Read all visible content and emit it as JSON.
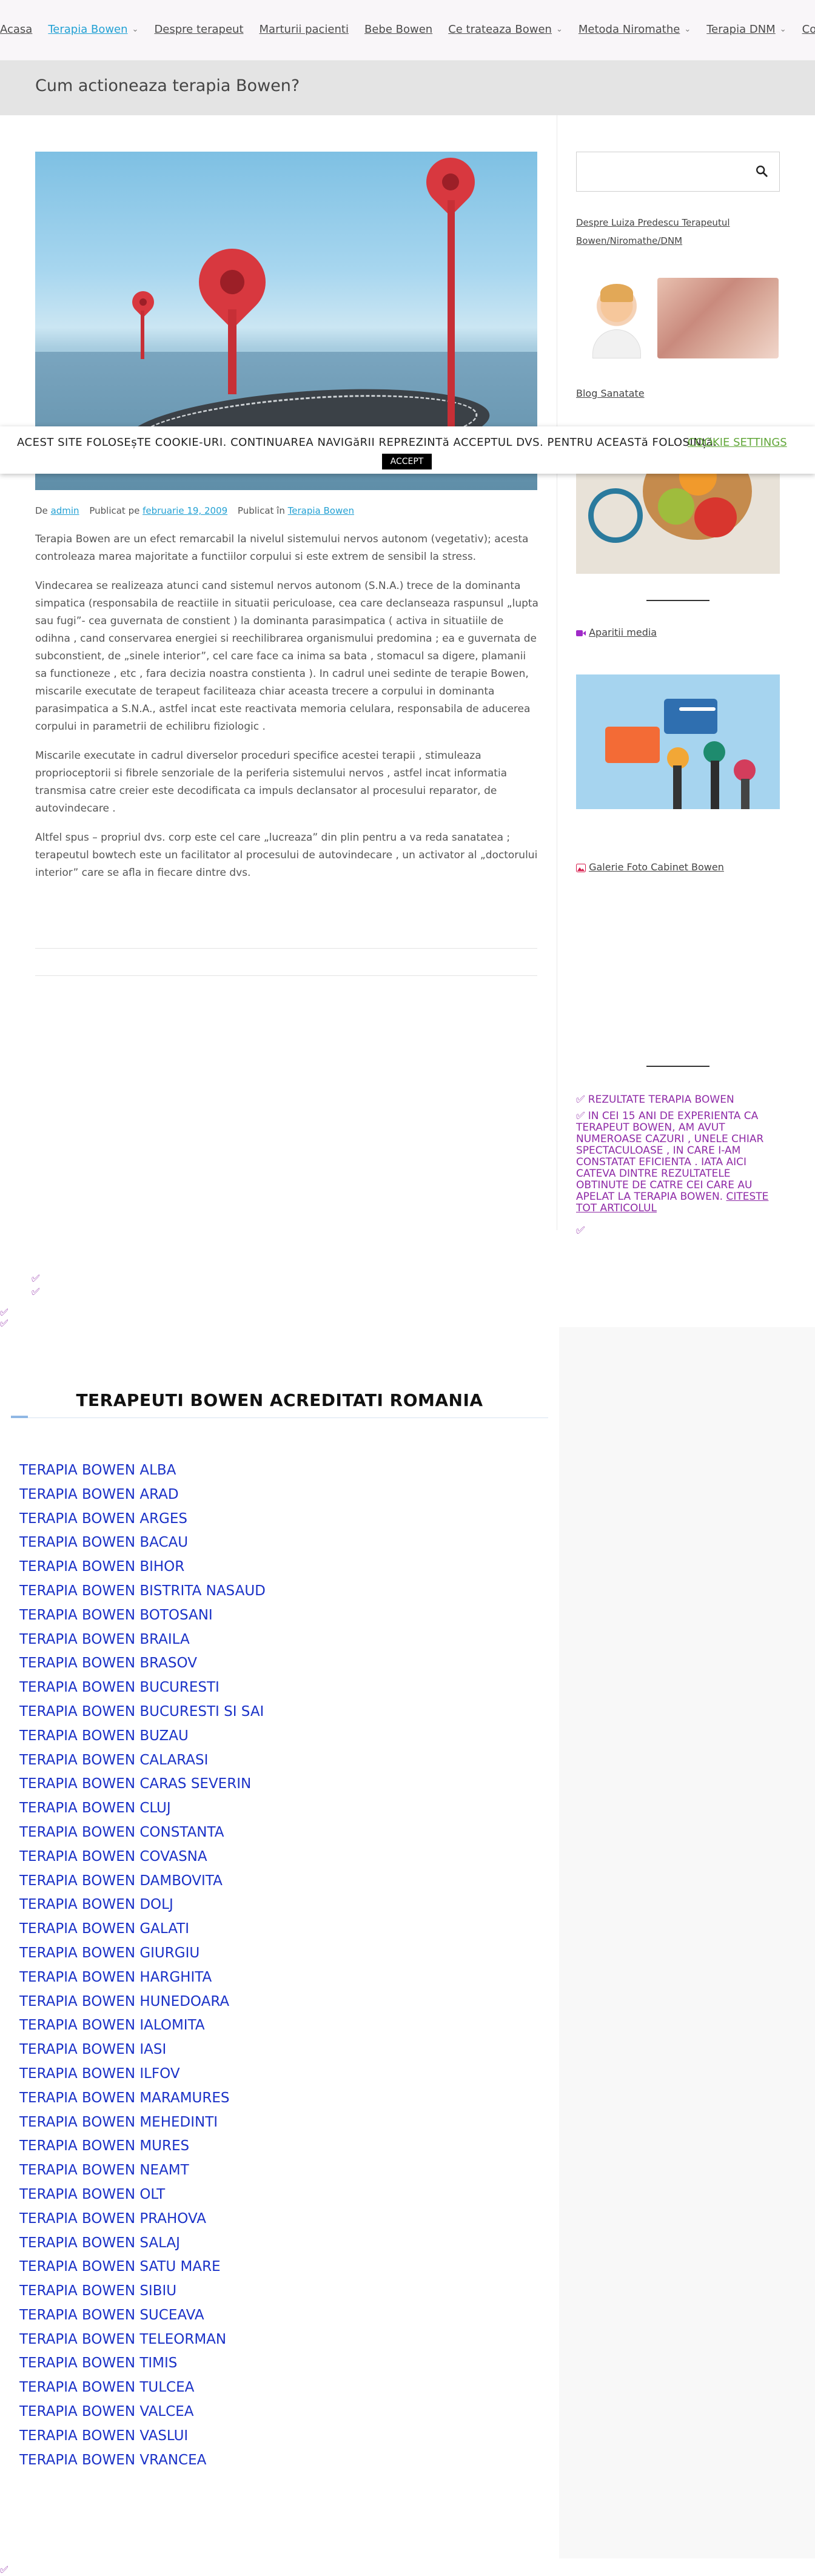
{
  "nav": {
    "items": [
      {
        "label": "Acasa",
        "dropdown": false,
        "active": false
      },
      {
        "label": "Terapia Bowen",
        "dropdown": true,
        "active": true
      },
      {
        "label": "Despre terapeut",
        "dropdown": false,
        "active": false
      },
      {
        "label": "Marturii pacienti",
        "dropdown": false,
        "active": false
      },
      {
        "label": "Bebe Bowen",
        "dropdown": false,
        "active": false
      },
      {
        "label": "Ce trateaza Bowen",
        "dropdown": true,
        "active": false
      },
      {
        "label": "Metoda Niromathe",
        "dropdown": true,
        "active": false
      },
      {
        "label": "Terapia DNM",
        "dropdown": true,
        "active": false
      },
      {
        "label": "Contact",
        "dropdown": false,
        "active": false
      }
    ],
    "accent_color": "#23a1d4"
  },
  "page": {
    "title": "Cum actioneaza terapia Bowen?"
  },
  "post_meta": {
    "by_label": "De",
    "author": "admin",
    "published_on_label": "Publicat pe",
    "date": "februarie 19, 2009",
    "published_in_label": "Publicat în",
    "category": "Terapia Bowen"
  },
  "article": {
    "paragraphs": [
      "Terapia Bowen are un efect remarcabil la nivelul sistemului nervos autonom (vegetativ); acesta controleaza marea majoritate a functiilor corpului si este extrem de sensibil la stress.",
      "Vindecarea se realizeaza atunci cand sistemul nervos autonom (S.N.A.) trece de la dominanta simpatica (responsabila de reactiile in situatii periculoase, cea care declanseaza raspunsul „lupta sau fugi”- cea guvernata de constient ) la dominanta parasimpatica ( activa in situatiile de odihna , cand conservarea energiei si reechilibrarea organismului predomina ; ea e guvernata de subconstient, de „sinele interior”, cel care face ca inima sa bata , stomacul sa digere, plamanii sa functioneze , etc , fara decizia noastra constienta ). In cadrul unei sedinte de terapie Bowen, miscarile executate de terapeut faciliteaza chiar aceasta trecere a corpului in dominanta parasimpatica a S.N.A., astfel incat este reactivata memoria celulara, responsabila de aducerea corpului in parametrii de echilibru fiziologic .",
      "Miscarile executate in cadrul diverselor proceduri specifice acestei terapii , stimuleaza proprioceptorii si fibrele senzoriale de la periferia sistemului nervos , astfel incat informatia transmisa catre creier este decodificata ca impuls declansator al procesului reparator, de autovindecare .",
      "Altfel spus – propriul dvs. corp este cel care „lucreaza” din plin pentru a va reda sanatatea ; terapeutul bowtech este un facilitator al procesului de autovindecare , un activator al „doctorului interior” care se afla in fiecare dintre dvs."
    ]
  },
  "sidebar": {
    "search": {
      "placeholder": "",
      "icon": "search-icon"
    },
    "about_link": "Despre Luiza Predescu Terapeutul Bowen/Niromathe/DNM",
    "blog_link": "Blog Sanatate",
    "media_link": "Aparitii media",
    "media_icon": "video-camera-icon",
    "gallery_link": "Galerie Foto Cabinet Bowen",
    "gallery_icon": "image-icon",
    "results_title": "REZULTATE TERAPIA BOWEN",
    "results_text": "IN CEI 15 ANI DE EXPERIENTA CA TERAPEUT BOWEN, AM AVUT NUMEROASE CAZURI , UNELE CHIAR SPECTACULOASE , IN CARE I-AM CONSTATAT EFICIENTA . IATA AICI CATEVA DINTRE REZULTATELE OBTINUTE DE CATRE CEI CARE AU APELAT LA TERAPIA BOWEN.",
    "results_link": "CITESTE TOT ARTICOLUL",
    "check_icon_color": "#8e2aa6"
  },
  "cookie": {
    "message": "ACEST SITE FOLOSEșTE COOKIE-URI. CONTINUAREA NAVIGăRII REPREZINTă ACCEPTUL DVS. PENTRU ACEASTă FOLOSINță.",
    "settings_label": "COOKIE SETTINGS",
    "accept_label": "ACCEPT"
  },
  "therapists": {
    "title": "TERAPEUTI BOWEN ACREDITATI ROMANIA",
    "link_color": "#1a31c7",
    "items": [
      "TERAPIA BOWEN ALBA",
      "TERAPIA BOWEN ARAD",
      "TERAPIA BOWEN ARGES",
      "TERAPIA BOWEN BACAU",
      "TERAPIA BOWEN BIHOR",
      "TERAPIA BOWEN BISTRITA NASAUD",
      "TERAPIA BOWEN BOTOSANI",
      "TERAPIA BOWEN BRAILA",
      "TERAPIA BOWEN BRASOV",
      "TERAPIA BOWEN BUCURESTI",
      "TERAPIA BOWEN BUCURESTI SI SAI",
      "TERAPIA BOWEN BUZAU",
      "TERAPIA BOWEN CALARASI",
      "TERAPIA BOWEN CARAS SEVERIN",
      "TERAPIA BOWEN CLUJ",
      "TERAPIA BOWEN CONSTANTA",
      "TERAPIA BOWEN COVASNA",
      "TERAPIA BOWEN DAMBOVITA",
      "TERAPIA BOWEN DOLJ",
      "TERAPIA BOWEN GALATI",
      "TERAPIA BOWEN GIURGIU",
      "TERAPIA BOWEN HARGHITA",
      "TERAPIA BOWEN HUNEDOARA",
      "TERAPIA BOWEN IALOMITA",
      "TERAPIA BOWEN IASI",
      "TERAPIA BOWEN ILFOV",
      "TERAPIA BOWEN MARAMURES",
      "TERAPIA BOWEN MEHEDINTI",
      "TERAPIA BOWEN MURES",
      "TERAPIA BOWEN NEAMT",
      "TERAPIA BOWEN OLT",
      "TERAPIA BOWEN PRAHOVA",
      "TERAPIA BOWEN SALAJ",
      "TERAPIA BOWEN SATU MARE",
      "TERAPIA BOWEN SIBIU",
      "TERAPIA BOWEN SUCEAVA",
      "TERAPIA BOWEN TELEORMAN",
      "TERAPIA BOWEN TIMIS",
      "TERAPIA BOWEN TULCEA",
      "TERAPIA BOWEN VALCEA",
      "TERAPIA BOWEN VASLUI",
      "TERAPIA BOWEN VRANCEA"
    ]
  }
}
